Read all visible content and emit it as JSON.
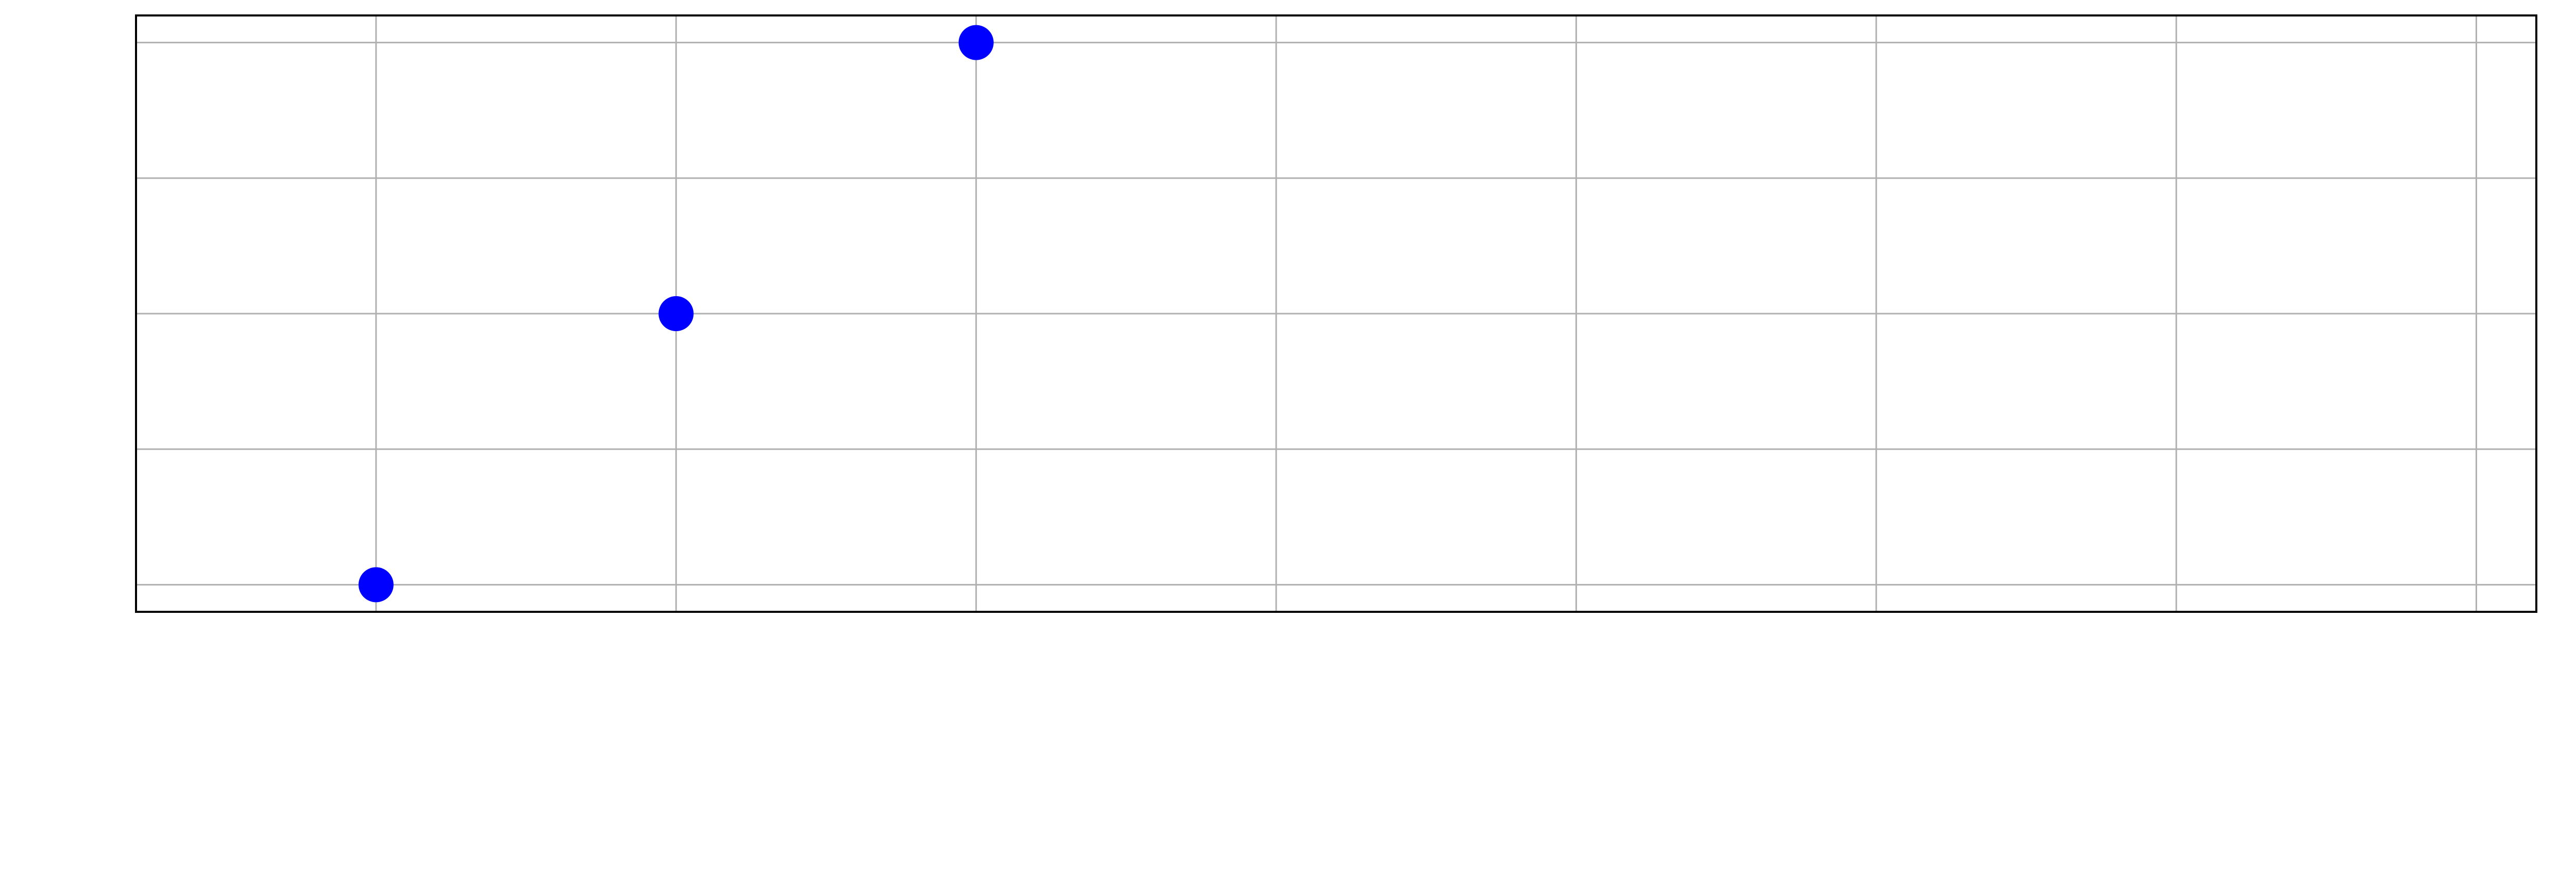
{
  "chart_data": {
    "type": "scatter",
    "title": "",
    "xlabel": "",
    "ylabel": "",
    "xlim": [
      0.2,
      8.2
    ],
    "ylim": [
      0.9,
      3.1
    ],
    "x_grid": [
      1,
      2,
      3,
      4,
      5,
      6,
      7,
      8
    ],
    "y_grid": [
      1,
      1.5,
      2,
      2.5,
      3
    ],
    "grid": true,
    "legend": "none",
    "series": [
      {
        "x": [
          1,
          2,
          3
        ],
        "y": [
          1,
          2,
          3
        ],
        "color": "#0000ff"
      }
    ],
    "colors": {
      "grid": "#b0b0b0",
      "axes_frame": "#000000",
      "marker": "#0000ff"
    }
  }
}
